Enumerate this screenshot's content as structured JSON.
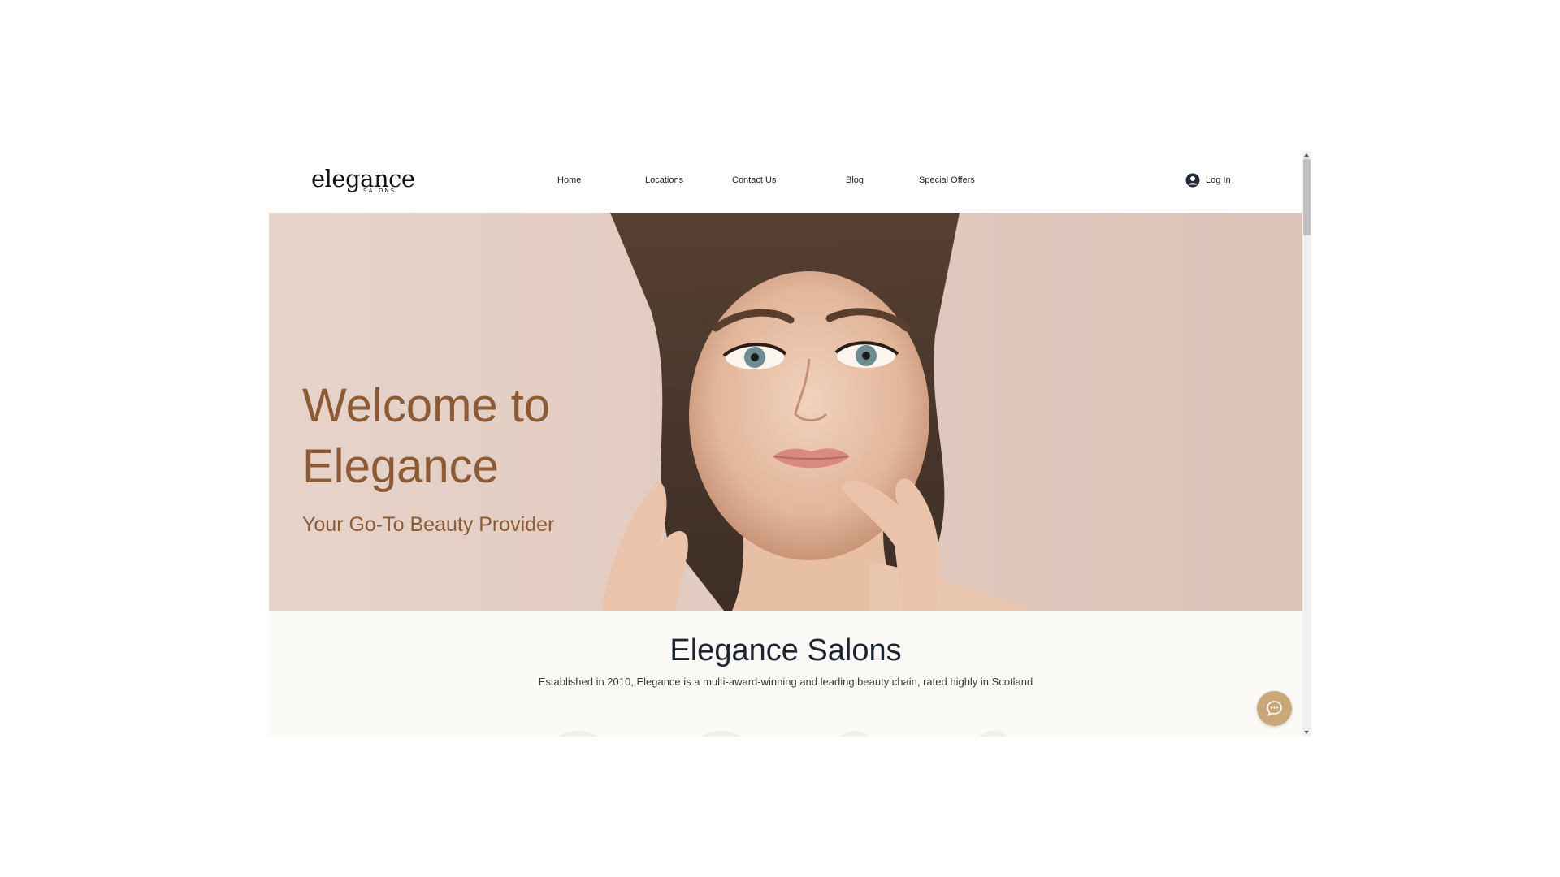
{
  "brand": {
    "logo_main": "elegance",
    "logo_sub": "SALONS"
  },
  "nav": {
    "items": [
      {
        "label": "Home"
      },
      {
        "label": "Locations"
      },
      {
        "label": "Contact Us"
      },
      {
        "label": "Blog"
      },
      {
        "label": "Special Offers"
      }
    ],
    "login_label": "Log In"
  },
  "hero": {
    "title": "Welcome to Elegance",
    "subtitle": "Your Go-To Beauty Provider"
  },
  "about": {
    "title": "Elegance Salons",
    "text": "Established in 2010, Elegance is a multi-award-winning and leading beauty chain, rated highly in Scotland"
  },
  "icons": {
    "login": "user-avatar-icon",
    "chat": "chat-bubble-icon"
  },
  "colors": {
    "hero_text": "#8c5a35",
    "hero_background": "#e2cbc1",
    "chat_button": "#c9a777",
    "section_background": "#fcfaf7",
    "heading": "#1d2431"
  }
}
